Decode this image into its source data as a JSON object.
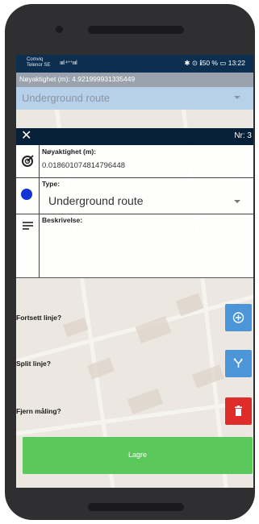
{
  "status_bar": {
    "carrier_line1": "Comviq",
    "carrier_line2": "Telenor SE",
    "signal_text": "ıııl ⁴⁺⁺ıııl",
    "right_text": "✱ ⊙ ℹ50 % ▭ 13:22"
  },
  "accuracy_bar": {
    "text": "Nøyaktighet (m): 4.921999931335449"
  },
  "route_select": {
    "value": "Underground route"
  },
  "panel": {
    "close_label": "✕",
    "number_label": "Nr: 3"
  },
  "form": {
    "accuracy": {
      "label": "Nøyaktighet (m):",
      "value": "0.018601074814796448"
    },
    "type": {
      "label": "Type:",
      "value": "Underground route",
      "dot_color": "#1333d6"
    },
    "description": {
      "label": "Beskrivelse:",
      "value": ""
    }
  },
  "options": [
    {
      "label": "Fortsett linje?",
      "icon": "add-circle-icon",
      "color": "#4c95d6"
    },
    {
      "label": "Split linje?",
      "icon": "split-icon",
      "color": "#4c95d6"
    },
    {
      "label": "Fjern måling?",
      "icon": "trash-icon",
      "color": "#e02b2b"
    }
  ],
  "save_button": {
    "label": "Lagre",
    "color": "#5ac85a"
  }
}
